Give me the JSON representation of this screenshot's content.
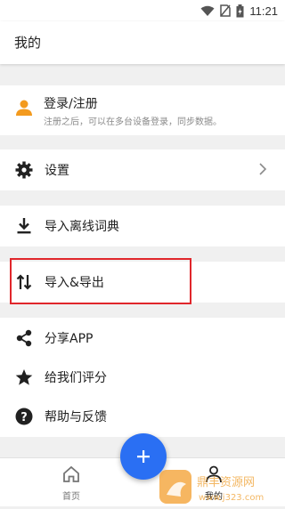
{
  "status": {
    "time": "11:21"
  },
  "appbar": {
    "title": "我的"
  },
  "login": {
    "title": "登录/注册",
    "subtitle": "注册之后，可以在多台设备登录，同步数据。"
  },
  "menu": {
    "settings": "设置",
    "import_dict": "导入离线词典",
    "import_export": "导入&导出",
    "share": "分享APP",
    "rate": "给我们评分",
    "help": "帮助与反馈"
  },
  "bottom_nav": {
    "home": "首页",
    "mine": "我的"
  },
  "watermark": {
    "text1": "鼎丰资源网",
    "text2": "www.j323.com"
  },
  "colors": {
    "accent": "#2a6ff3",
    "login_icon": "#f39a1e",
    "highlight": "#e0262b"
  }
}
